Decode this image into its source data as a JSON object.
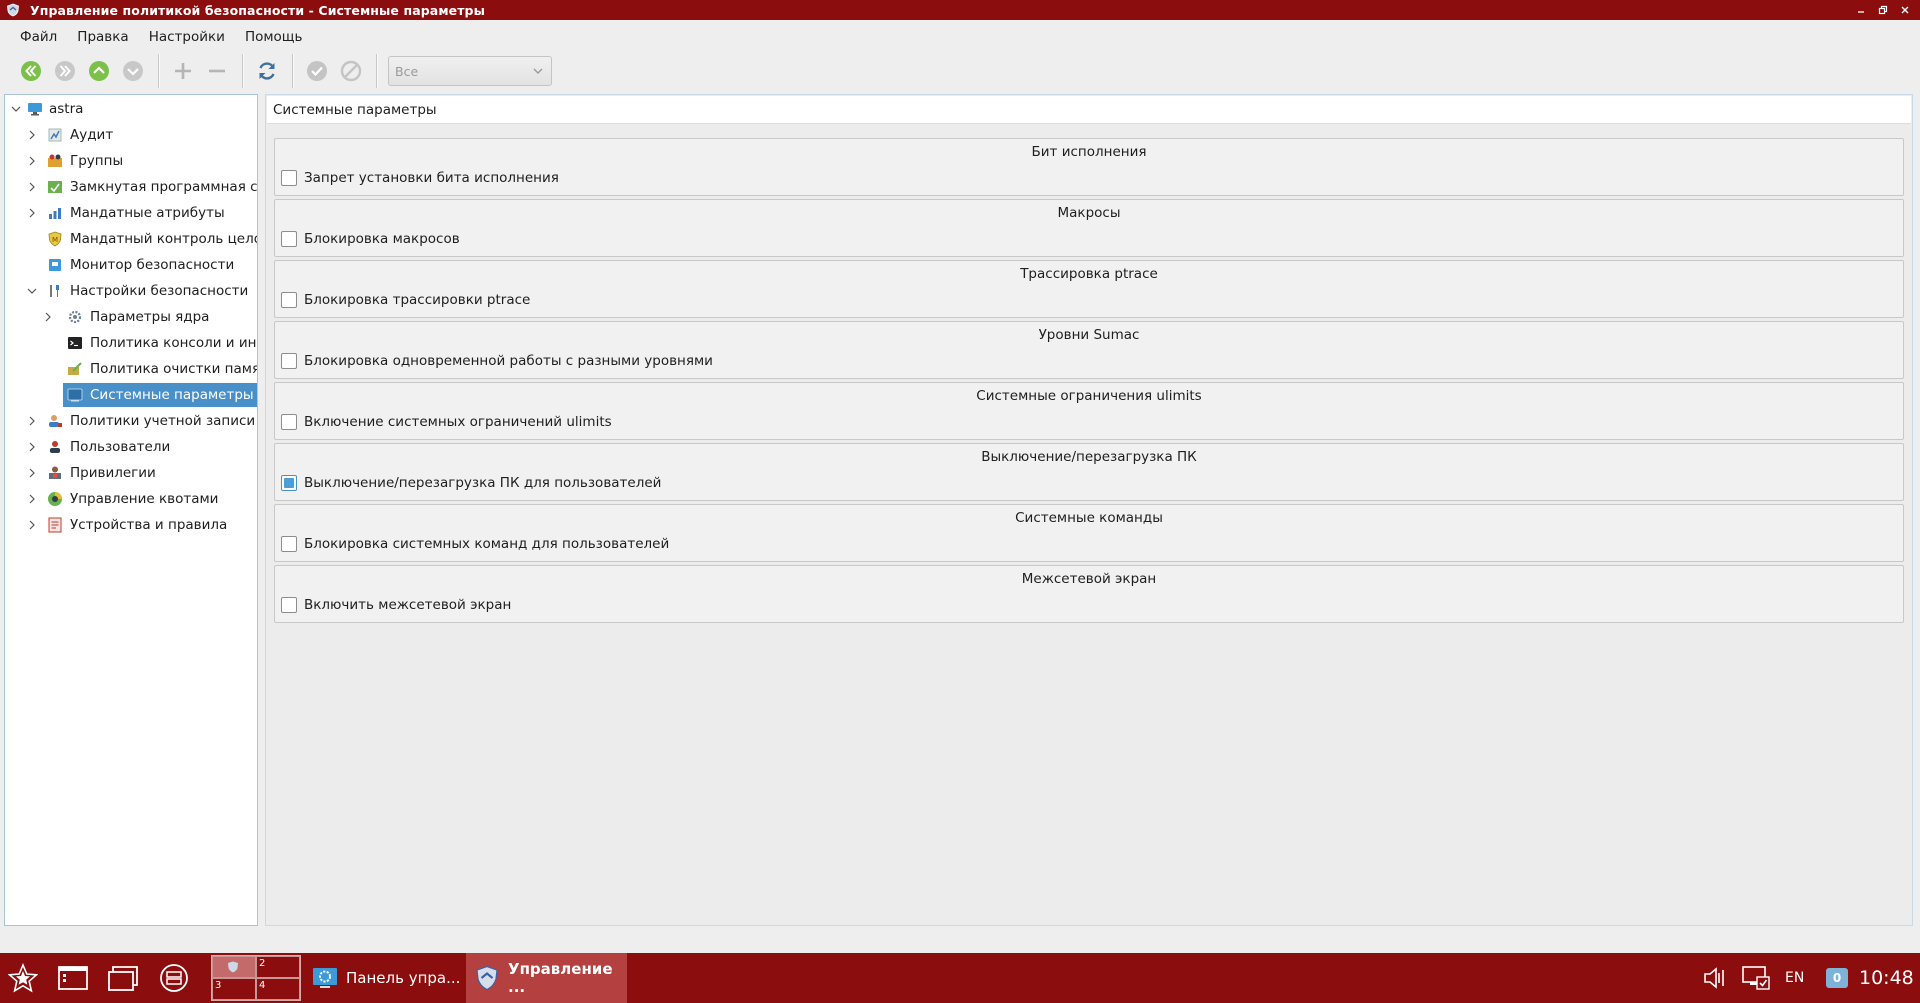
{
  "window": {
    "title": "Управление политикой безопасности - Системные параметры",
    "controls": [
      "minimize",
      "restore",
      "close"
    ]
  },
  "menu": {
    "items": [
      "Файл",
      "Правка",
      "Настройки",
      "Помощь"
    ]
  },
  "toolbar": {
    "buttons": [
      "back-icon",
      "forward-icon",
      "up-icon",
      "down-icon",
      "plus-icon",
      "minus-icon",
      "refresh-icon",
      "apply-icon",
      "cancel-icon"
    ],
    "filter_value": "Все"
  },
  "tree": {
    "root": "astra",
    "items": [
      {
        "label": "astra"
      },
      {
        "label": "Аудит"
      },
      {
        "label": "Группы"
      },
      {
        "label": "Замкнутая программная с..."
      },
      {
        "label": "Мандатные атрибуты"
      },
      {
        "label": "Мандатный контроль цело..."
      },
      {
        "label": "Монитор безопасности"
      },
      {
        "label": "Настройки безопасности"
      },
      {
        "label": "Параметры ядра"
      },
      {
        "label": "Политика консоли и ин..."
      },
      {
        "label": "Политика очистки памя..."
      },
      {
        "label": "Системные параметры"
      },
      {
        "label": "Политики учетной записи"
      },
      {
        "label": "Пользователи"
      },
      {
        "label": "Привилегии"
      },
      {
        "label": "Управление квотами"
      },
      {
        "label": "Устройства и правила"
      }
    ],
    "selected": "Системные параметры"
  },
  "content": {
    "header": "Системные параметры",
    "groups": [
      {
        "title": "Бит исполнения",
        "option": "Запрет установки бита исполнения",
        "checked": false
      },
      {
        "title": "Макросы",
        "option": "Блокировка макросов",
        "checked": false
      },
      {
        "title": "Трассировка ptrace",
        "option": "Блокировка трассировки ptrace",
        "checked": false
      },
      {
        "title": "Уровни Sumac",
        "option": "Блокировка одновременной работы с разными уровнями",
        "checked": false
      },
      {
        "title": "Системные ограничения ulimits",
        "option": "Включение системных ограничений ulimits",
        "checked": false
      },
      {
        "title": "Выключение/перезагрузка ПК",
        "option": "Выключение/перезагрузка ПК для пользователей",
        "checked": true
      },
      {
        "title": "Системные команды",
        "option": "Блокировка системных команд для пользователей",
        "checked": false
      },
      {
        "title": "Межсетевой экран",
        "option": "Включить межсетевой экран",
        "checked": false
      }
    ]
  },
  "taskbar": {
    "pager": [
      "2",
      "3",
      "4"
    ],
    "tasks": [
      {
        "label": "Панель упра...",
        "active": false
      },
      {
        "label": "Управление ...",
        "active": true
      }
    ],
    "language": "EN",
    "notifications": "0",
    "clock": "10:48"
  },
  "colors": {
    "titlebar": "#8b0d0d",
    "selection": "#4a90c8",
    "taskbar_active": "#b44040"
  }
}
